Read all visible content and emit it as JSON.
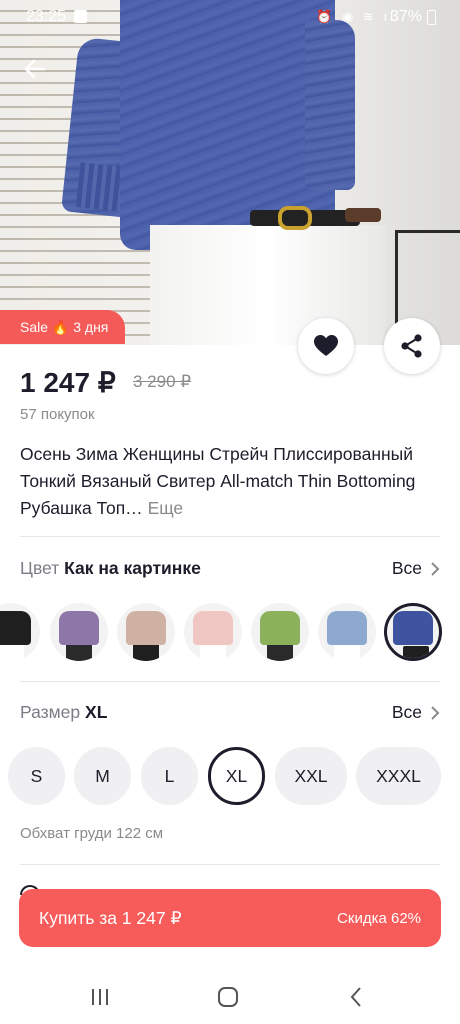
{
  "status_bar": {
    "time": "23:25",
    "battery": "37%",
    "icons": "⏰ ◉ ≋ ıl"
  },
  "sale_badge": {
    "label": "Sale 🔥 3 дня"
  },
  "product": {
    "price": "1 247 ₽",
    "old_price": "3 290 ₽",
    "purchases": "57 покупок",
    "title": "Осень Зима Женщины Стрейч Плиссированный Тонкий Вязаный Свитер All-match Thin Bottoming Рубашка Топ…",
    "more_label": "Еще"
  },
  "color_section": {
    "label": "Цвет",
    "value": "Как на картинке",
    "all_label": "Все",
    "swatches": [
      {
        "top": "#1f1f1f",
        "bottom": "#ffffff"
      },
      {
        "top": "#8e77a8",
        "bottom": "#2a2a2a"
      },
      {
        "top": "#cfb2a4",
        "bottom": "#1f1f1f"
      },
      {
        "top": "#efc6c2",
        "bottom": "#ffffff"
      },
      {
        "top": "#8bb15a",
        "bottom": "#2a2a2a"
      },
      {
        "top": "#8ea9cf",
        "bottom": "#ffffff"
      },
      {
        "top": "#3e54a0",
        "bottom": "#1f1f1f"
      }
    ],
    "selected_index": 6
  },
  "size_section": {
    "label": "Размер",
    "value": "XL",
    "all_label": "Все",
    "sizes": [
      "S",
      "M",
      "L",
      "XL",
      "XXL",
      "XXXL"
    ],
    "selected_index": 3,
    "chest_note": "Обхват груди 122 см"
  },
  "buy_button": {
    "label": "Купить за 1 247 ₽",
    "discount": "Скидка 62%"
  },
  "colors": {
    "accent": "#f75c5a",
    "text": "#1d1d2b",
    "muted": "#8a8a8a"
  }
}
